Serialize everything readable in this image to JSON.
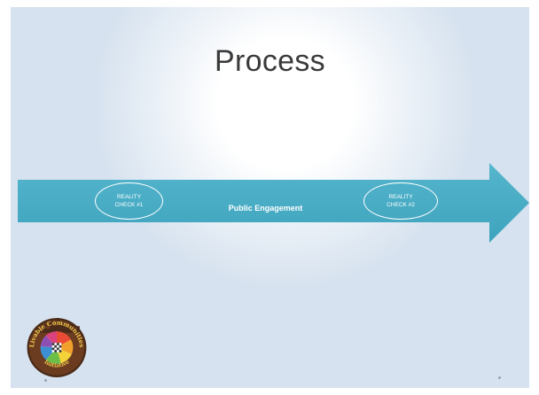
{
  "slide": {
    "title": "Process",
    "background_color": "#d6e2ef",
    "arrow_color": "#4aaec6"
  },
  "diagram": {
    "center_label": "Public Engagement",
    "checkpoints": [
      {
        "line1": "REALITY",
        "line2": "CHECK #1"
      },
      {
        "line1": "REALITY",
        "line2": "CHECK #2"
      }
    ]
  },
  "logo": {
    "text_top": "Livable Communities",
    "text_bottom": "Initiative",
    "icon": "livable-communities-logo"
  }
}
